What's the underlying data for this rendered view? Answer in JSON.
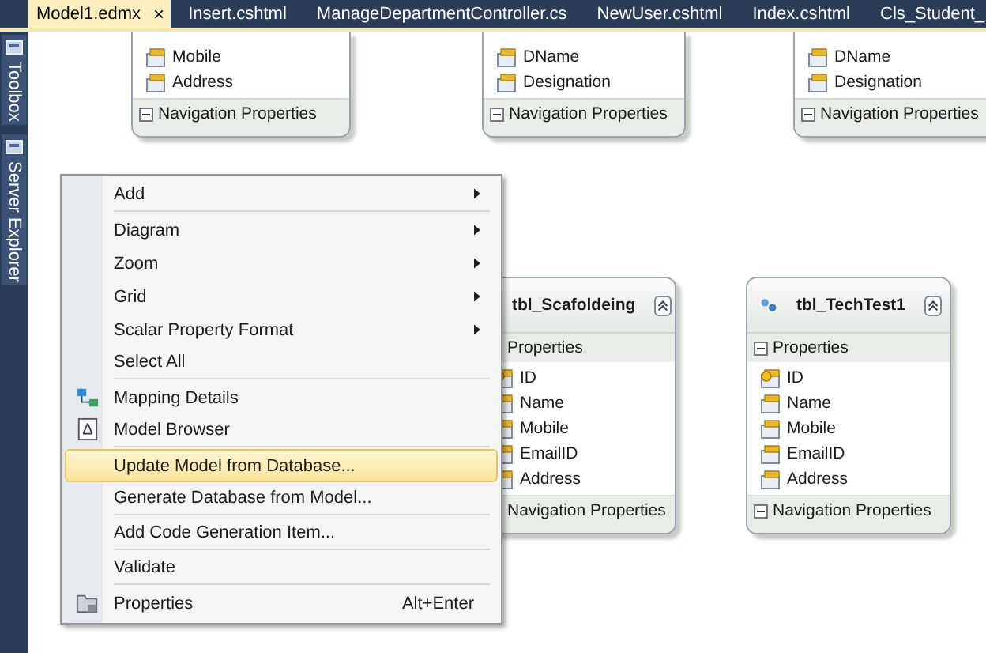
{
  "tabs": [
    {
      "label": "Model1.edmx",
      "selected": true,
      "close": "×"
    },
    {
      "label": "Insert.cshtml",
      "selected": false
    },
    {
      "label": "ManageDepartmentController.cs",
      "selected": false
    },
    {
      "label": "NewUser.cshtml",
      "selected": false
    },
    {
      "label": "Index.cshtml",
      "selected": false
    },
    {
      "label": "Cls_Student_",
      "selected": false
    }
  ],
  "side_panel": [
    {
      "label": "Toolbox"
    },
    {
      "label": "Server Explorer"
    }
  ],
  "entities": [
    {
      "properties": [
        {
          "name": "Mobile",
          "key": false
        },
        {
          "name": "Address",
          "key": false
        }
      ],
      "navigation_label": "Navigation Properties"
    },
    {
      "properties": [
        {
          "name": "DName",
          "key": false
        },
        {
          "name": "Designation",
          "key": false
        }
      ],
      "navigation_label": "Navigation Properties"
    },
    {
      "properties": [
        {
          "name": "DName",
          "key": false
        },
        {
          "name": "Designation",
          "key": false
        }
      ],
      "navigation_label": "Navigation Properties"
    },
    {
      "title": "tbl_Scafoldeing",
      "toggles_visible": false,
      "properties_label": "Properties",
      "properties": [
        {
          "name": "ID",
          "key": true
        },
        {
          "name": "Name",
          "key": false
        },
        {
          "name": "Mobile",
          "key": false
        },
        {
          "name": "EmailID",
          "key": false
        },
        {
          "name": "Address",
          "key": false
        }
      ],
      "navigation_label": "Navigation Properties"
    },
    {
      "title": "tbl_TechTest1",
      "toggles_visible": true,
      "properties_label": "Properties",
      "properties": [
        {
          "name": "ID",
          "key": true
        },
        {
          "name": "Name",
          "key": false
        },
        {
          "name": "Mobile",
          "key": false
        },
        {
          "name": "EmailID",
          "key": false
        },
        {
          "name": "Address",
          "key": false
        }
      ],
      "navigation_label": "Navigation Properties"
    }
  ],
  "context_menu": [
    {
      "label": "Add",
      "submenu": true,
      "selected": false,
      "separator_after": true
    },
    {
      "label": "Diagram",
      "submenu": true,
      "selected": false
    },
    {
      "label": "Zoom",
      "submenu": true,
      "selected": false
    },
    {
      "label": "Grid",
      "submenu": true,
      "selected": false
    },
    {
      "label": "Scalar Property Format",
      "submenu": true,
      "selected": false
    },
    {
      "label": "Select All",
      "submenu": false,
      "selected": false,
      "separator_after": true
    },
    {
      "label": "Mapping Details",
      "submenu": false,
      "selected": false
    },
    {
      "label": "Model Browser",
      "submenu": false,
      "selected": false,
      "separator_after": true
    },
    {
      "label": "Update Model from Database...",
      "submenu": false,
      "selected": true
    },
    {
      "label": "Generate Database from Model...",
      "submenu": false,
      "selected": false,
      "separator_after": true
    },
    {
      "label": "Add Code Generation Item...",
      "submenu": false,
      "selected": false,
      "separator_after": true
    },
    {
      "label": "Validate",
      "submenu": false,
      "selected": false,
      "separator_after": true
    },
    {
      "label": "Properties",
      "submenu": false,
      "selected": false,
      "shortcut": "Alt+Enter"
    }
  ]
}
